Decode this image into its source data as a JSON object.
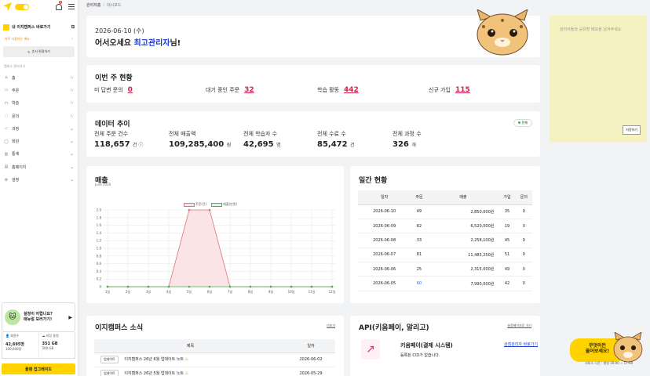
{
  "sidebar": {
    "shortcut": "내 이지캠퍼스 바로가기",
    "favorites": "자주 사용하는 메뉴",
    "add_fav": "순서 편경하기",
    "section": "캠퍼스 관리하기",
    "items": [
      {
        "label": "홈",
        "icon": "home-icon",
        "tail": "☆"
      },
      {
        "label": "주문",
        "icon": "order-icon",
        "tail": "☆"
      },
      {
        "label": "학습",
        "icon": "bookmark-icon",
        "tail": "☆"
      },
      {
        "label": "문의",
        "icon": "chat-icon",
        "tail": "☆"
      },
      {
        "label": "과정",
        "icon": "folder-icon",
        "tail": "⌄"
      },
      {
        "label": "회원",
        "icon": "user-icon",
        "tail": "⌄"
      },
      {
        "label": "통계",
        "icon": "stats-icon",
        "tail": "⌄"
      },
      {
        "label": "홈페이지",
        "icon": "homepage-icon",
        "tail": "⌄"
      },
      {
        "label": "설정",
        "icon": "gear-icon",
        "tail": "⌄"
      }
    ],
    "help_title": "설정이 어렵나요?",
    "help_sub": "매뉴얼 보러가기!",
    "members_label": "회원수",
    "members_val": "42,695명",
    "members_max": "100,000명",
    "storage_label": "저장 용량",
    "storage_val": "351 GB",
    "storage_max": "500 GB",
    "upgrade": "플랜 업그레이드"
  },
  "breadcrumb": {
    "root": "관리자홈",
    "current": "대시보드"
  },
  "welcome": {
    "date": "2026-06-10 (수)",
    "greet": "어서오세요 ",
    "name": "최고관리자",
    "suffix": "님!"
  },
  "weekly": {
    "title": "이번 주 현황",
    "items": [
      {
        "label": "미 답변 문의",
        "value": "0"
      },
      {
        "label": "대기 중인 주문",
        "value": "32"
      },
      {
        "label": "학습 활동",
        "value": "442"
      },
      {
        "label": "신규 가입",
        "value": "115"
      }
    ]
  },
  "trend": {
    "title": "데이터 추이",
    "pill": "전체",
    "items": [
      {
        "label": "전체 주문 건수",
        "value": "118,657",
        "unit": "건 ⓘ"
      },
      {
        "label": "전체 매출액",
        "value": "109,285,400",
        "unit": "원"
      },
      {
        "label": "전체 학습자 수",
        "value": "42,695",
        "unit": "명"
      },
      {
        "label": "전체 수료 수",
        "value": "85,472",
        "unit": "건"
      },
      {
        "label": "전체 과정 수",
        "value": "326",
        "unit": "개"
      }
    ]
  },
  "sales": {
    "title": "매출",
    "subtitle": "June 2026",
    "legend_a": "주문(건)",
    "legend_b": "매출(만원)"
  },
  "chart_data": {
    "type": "area",
    "categories": [
      "1일",
      "2일",
      "3일",
      "4일",
      "5일",
      "6일",
      "7일",
      "8일",
      "9일",
      "10일",
      "11일",
      "12일"
    ],
    "series": [
      {
        "name": "주문(건)",
        "values": [
          0,
          0,
          0,
          0,
          2,
          2,
          0,
          0,
          0,
          0,
          0,
          0
        ],
        "color": "#e0707a"
      },
      {
        "name": "매출(만원)",
        "values": [
          0,
          0,
          0,
          0,
          0,
          0,
          0,
          0,
          0,
          0,
          0,
          0
        ],
        "color": "#4caf50"
      }
    ],
    "ylim": [
      0,
      2.0
    ],
    "yticks": [
      "0",
      "0.2",
      "0.4",
      "0.6",
      "0.8",
      "1.0",
      "1.2",
      "1.4",
      "1.6",
      "1.8",
      "2.0"
    ]
  },
  "daily": {
    "title": "일간 현황",
    "headers": [
      "일자",
      "주문",
      "매출",
      "가입",
      "문의"
    ],
    "rows": [
      [
        "2026-06-10",
        "49",
        "2,850,000원",
        "35",
        "0"
      ],
      [
        "2026-06-09",
        "82",
        "6,520,000원",
        "19",
        "0"
      ],
      [
        "2026-06-08",
        "33",
        "2,258,100원",
        "45",
        "0"
      ],
      [
        "2026-06-07",
        "81",
        "11,485,250원",
        "51",
        "0"
      ],
      [
        "2026-06-06",
        "25",
        "2,315,000원",
        "49",
        "0"
      ],
      [
        "2026-06-05",
        "60",
        "7,990,000원",
        "42",
        "0"
      ]
    ]
  },
  "news": {
    "title": "이지캠퍼스 소식",
    "more": "더보기",
    "headers": [
      "제목",
      "일자"
    ],
    "rows": [
      {
        "tag": "업데이트",
        "title": "이지캠퍼스 26년 6월 업데이트 노트",
        "date": "2026-06-02"
      },
      {
        "tag": "업데이트",
        "title": "이지캠퍼스 26년 5월 업데이트 노트",
        "date": "2026-05-29"
      }
    ]
  },
  "api": {
    "title": "API(키움페이, 알리고)",
    "more": "설정페이지로 가기",
    "service": "키움페이(결제 시스템)",
    "link": "상점관리자 바로가기",
    "status": "등록된 CID가 없습니다."
  },
  "memo": {
    "placeholder": "관리자들과 공유할 메모을 남겨주세요.",
    "save": "저장하기"
  },
  "floating": {
    "line1": "무엇이든",
    "line2": "물어보세요!",
    "hours": "서비스 시간 : 평일 10:00 ~ 17:00"
  }
}
